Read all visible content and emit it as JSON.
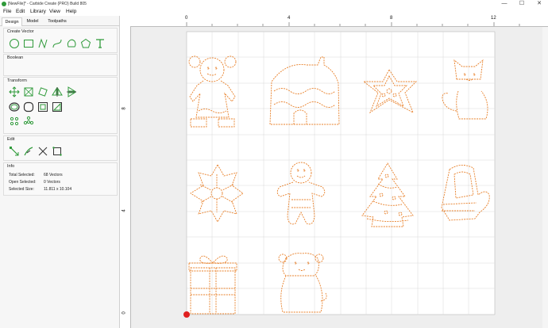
{
  "window": {
    "title": "[NewFile]* - Carbide Create (PRO) Build 805",
    "min_label": "—",
    "max_label": "☐",
    "close_label": "✕"
  },
  "menu": [
    "File",
    "Edit",
    "Library",
    "View",
    "Help"
  ],
  "tabs": [
    "Design",
    "Model",
    "Toolpaths"
  ],
  "sections": {
    "create_vector": "Create Vector",
    "boolean": "Boolean",
    "transform": "Transform",
    "edit": "Edit",
    "info": "Info"
  },
  "info": {
    "total_selected_label": "Total Selected:",
    "total_selected_value": "68 Vectors",
    "open_selected_label": "Open Selected:",
    "open_selected_value": "0 Vectors",
    "selected_size_label": "Selected Size:",
    "selected_size_value": "11.811 x 10.104"
  },
  "ruler": {
    "top_ticks": [
      "0",
      "4",
      "8",
      "12"
    ],
    "left_ticks": [
      "8",
      "4",
      "0"
    ]
  },
  "colors": {
    "accent": "#2f9a3a",
    "vector": "#e8802a",
    "grid": "#d8d8d8"
  }
}
